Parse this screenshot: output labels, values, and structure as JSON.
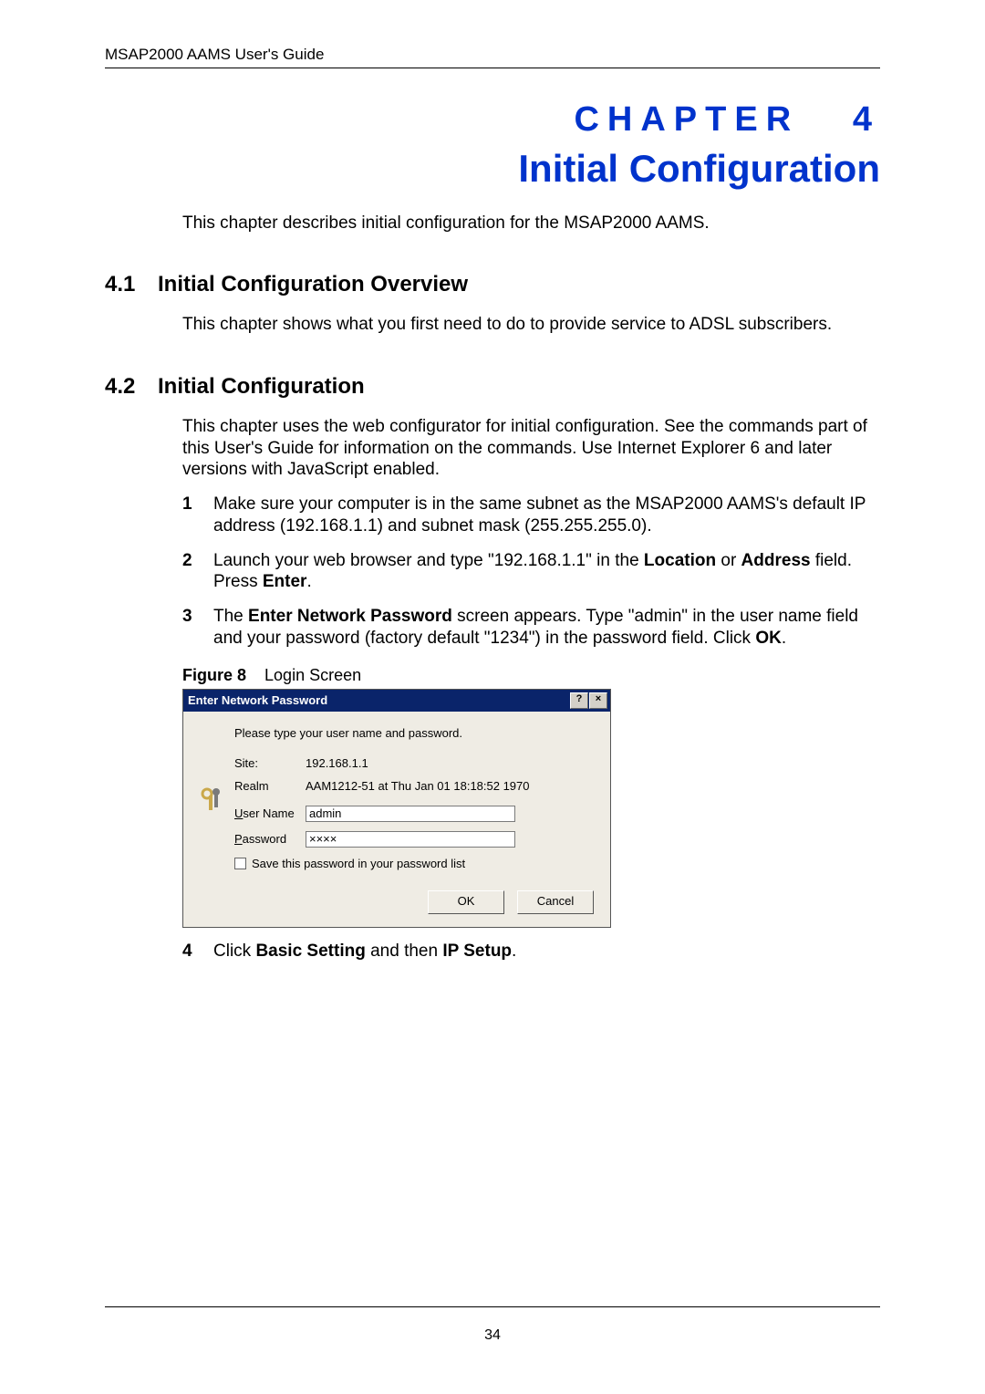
{
  "header": "MSAP2000 AAMS User's Guide",
  "chapter": {
    "label": "CHAPTER",
    "number": "4",
    "title": "Initial Configuration"
  },
  "chapter_intro": "This chapter describes initial configuration for the MSAP2000 AAMS.",
  "sections": {
    "s41_num": "4.1",
    "s41_title": "Initial Configuration Overview",
    "s41_body": "This chapter shows what you first need to do to provide service to ADSL subscribers.",
    "s42_num": "4.2",
    "s42_title": "Initial Configuration",
    "s42_body": "This chapter uses the web configurator for initial configuration. See the commands part of this User's Guide for information on the commands. Use Internet Explorer 6 and later versions with JavaScript enabled."
  },
  "steps": {
    "n1": "1",
    "t1": "Make sure your computer is in the same subnet as the MSAP2000 AAMS's default IP address (192.168.1.1) and subnet mask (255.255.255.0).",
    "n2": "2",
    "t2_a": " Launch your web browser and type \"192.168.1.1\" in the ",
    "t2_b1": "Location",
    "t2_c": " or ",
    "t2_b2": "Address",
    "t2_d": " field. Press ",
    "t2_b3": "Enter",
    "t2_e": ".",
    "n3": "3",
    "t3_a": "The ",
    "t3_b1": "Enter Network Password",
    "t3_c": " screen appears. Type \"admin\" in the user name field and your password (factory default \"1234\") in the password field. Click ",
    "t3_b2": "OK",
    "t3_d": ".",
    "n4": "4",
    "t4_a": "Click ",
    "t4_b1": "Basic Setting",
    "t4_c": " and then ",
    "t4_b2": "IP Setup",
    "t4_d": "."
  },
  "figure": {
    "label": "Figure 8",
    "caption": "Login Screen"
  },
  "dialog": {
    "title": "Enter Network Password",
    "help_btn": "?",
    "close_btn": "×",
    "prompt": "Please type your user name and password.",
    "site_label": "Site:",
    "site_value": "192.168.1.1",
    "realm_label": "Realm",
    "realm_value": "AAM1212-51 at Thu Jan 01 18:18:52 1970",
    "user_label_pre": "U",
    "user_label_post": "ser Name",
    "user_value": "admin",
    "pass_label_pre": "P",
    "pass_label_post": "assword",
    "pass_value": "××××",
    "save_pre": "S",
    "save_post": "ave this password in your password list",
    "ok": "OK",
    "cancel": "Cancel"
  },
  "page_number": "34"
}
